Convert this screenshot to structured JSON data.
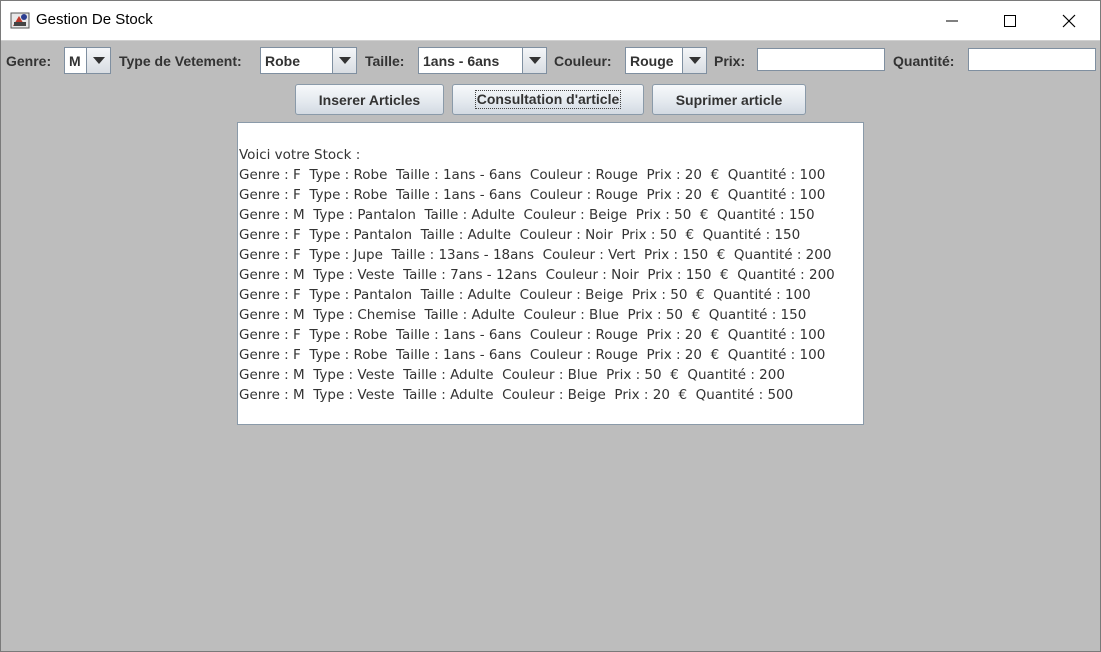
{
  "window": {
    "title": "Gestion De Stock"
  },
  "form": {
    "genre_label": "Genre:",
    "genre_value": "M",
    "type_label": "Type de Vetement:",
    "type_value": "Robe",
    "taille_label": "Taille:",
    "taille_value": "1ans - 6ans",
    "couleur_label": "Couleur:",
    "couleur_value": "Rouge",
    "prix_label": "Prix:",
    "prix_value": "",
    "quantite_label": "Quantité:",
    "quantite_value": ""
  },
  "buttons": {
    "insert": "Inserer Articles",
    "consult": "Consultation d'article",
    "delete": "Suprimer article"
  },
  "stock": {
    "header": "Voici votre Stock :",
    "lines": [
      "Genre : F  Type : Robe  Taille : 1ans - 6ans  Couleur : Rouge  Prix : 20  €  Quantité : 100",
      "Genre : F  Type : Robe  Taille : 1ans - 6ans  Couleur : Rouge  Prix : 20  €  Quantité : 100",
      "Genre : M  Type : Pantalon  Taille : Adulte  Couleur : Beige  Prix : 50  €  Quantité : 150",
      "Genre : F  Type : Pantalon  Taille : Adulte  Couleur : Noir  Prix : 50  €  Quantité : 150",
      "Genre : F  Type : Jupe  Taille : 13ans - 18ans  Couleur : Vert  Prix : 150  €  Quantité : 200",
      "Genre : M  Type : Veste  Taille : 7ans - 12ans  Couleur : Noir  Prix : 150  €  Quantité : 200",
      "Genre : F  Type : Pantalon  Taille : Adulte  Couleur : Beige  Prix : 50  €  Quantité : 100",
      "Genre : M  Type : Chemise  Taille : Adulte  Couleur : Blue  Prix : 50  €  Quantité : 150",
      "Genre : F  Type : Robe  Taille : 1ans - 6ans  Couleur : Rouge  Prix : 20  €  Quantité : 100",
      "Genre : F  Type : Robe  Taille : 1ans - 6ans  Couleur : Rouge  Prix : 20  €  Quantité : 100",
      "Genre : M  Type : Veste  Taille : Adulte  Couleur : Blue  Prix : 50  €  Quantité : 200",
      "Genre : M  Type : Veste  Taille : Adulte  Couleur : Beige  Prix : 20  €  Quantité : 500"
    ]
  }
}
